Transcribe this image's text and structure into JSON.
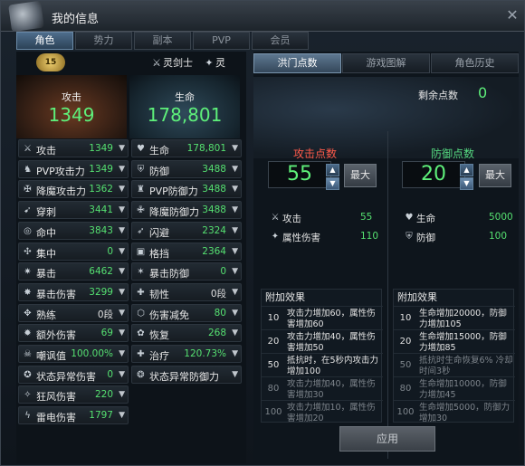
{
  "window": {
    "title": "我的信息"
  },
  "main_tabs": [
    {
      "label": "角色",
      "active": true
    },
    {
      "label": "势力",
      "active": false
    },
    {
      "label": "副本",
      "active": false
    },
    {
      "label": "PVP",
      "active": false
    },
    {
      "label": "会员",
      "active": false
    }
  ],
  "left": {
    "rank_badge": "15",
    "class1": "灵剑士",
    "class2": "灵",
    "attack": {
      "label": "攻击",
      "value": "1349"
    },
    "life": {
      "label": "生命",
      "value": "178,801"
    },
    "stats_left": [
      {
        "icon": "sword-icon",
        "name": "攻击",
        "value": "1349"
      },
      {
        "icon": "pvp-attack-icon",
        "name": "PVP攻击力",
        "value": "1349"
      },
      {
        "icon": "demon-attack-icon",
        "name": "降魔攻击力",
        "value": "1362"
      },
      {
        "icon": "pierce-icon",
        "name": "穿刺",
        "value": "3441"
      },
      {
        "icon": "target-icon",
        "name": "命中",
        "value": "3843"
      },
      {
        "icon": "focus-icon",
        "name": "集中",
        "value": "0"
      },
      {
        "icon": "crit-icon",
        "name": "暴击",
        "value": "6462"
      },
      {
        "icon": "crit-damage-icon",
        "name": "暴击伤害",
        "value": "3299"
      },
      {
        "icon": "skill-icon",
        "name": "熟练",
        "value": "0段"
      },
      {
        "icon": "extra-damage-icon",
        "name": "额外伤害",
        "value": "69"
      },
      {
        "icon": "skull-icon",
        "name": "嘲讽值",
        "value": "100.00%"
      },
      {
        "icon": "status-attack-icon",
        "name": "状态异常伤害",
        "value": "0"
      },
      {
        "icon": "berserk-icon",
        "name": "狂风伤害",
        "value": "220"
      },
      {
        "icon": "thunder-icon",
        "name": "雷电伤害",
        "value": "1797"
      }
    ],
    "stats_right": [
      {
        "icon": "heart-icon",
        "name": "生命",
        "value": "178,801"
      },
      {
        "icon": "shield-icon",
        "name": "防御",
        "value": "3488"
      },
      {
        "icon": "pvp-defense-icon",
        "name": "PVP防御力",
        "value": "3488"
      },
      {
        "icon": "demon-defense-icon",
        "name": "降魔防御力",
        "value": "3488"
      },
      {
        "icon": "evade-icon",
        "name": "闪避",
        "value": "2324"
      },
      {
        "icon": "block-icon",
        "name": "格挡",
        "value": "2364"
      },
      {
        "icon": "crit-defense-icon",
        "name": "暴击防御",
        "value": "0"
      },
      {
        "icon": "toughness-icon",
        "name": "韧性",
        "value": "0段"
      },
      {
        "icon": "damage-reduce-icon",
        "name": "伤害减免",
        "value": "80"
      },
      {
        "icon": "recover-icon",
        "name": "恢复",
        "value": "268"
      },
      {
        "icon": "heal-icon",
        "name": "治疗",
        "value": "120.73%"
      },
      {
        "icon": "status-defense-icon",
        "name": "状态异常防御力",
        "value": ""
      }
    ]
  },
  "right": {
    "sub_tabs": [
      {
        "label": "洪门点数",
        "active": true
      },
      {
        "label": "游戏图解",
        "active": false
      },
      {
        "label": "角色历史",
        "active": false
      }
    ],
    "remaining_label": "剩余点数",
    "remaining_value": "0",
    "attack_points": {
      "label": "攻击点数",
      "value": "55",
      "max_label": "最大",
      "effects": [
        {
          "icon": "sword-icon",
          "name": "攻击",
          "value": "55"
        },
        {
          "icon": "element-icon",
          "name": "属性伤害",
          "value": "110"
        }
      ],
      "bonus_title": "附加效果",
      "bonus": [
        {
          "level": "10",
          "text": "攻击力增加60，属性伤害增加60",
          "active": true
        },
        {
          "level": "20",
          "text": "攻击力增加40，属性伤害增加50",
          "active": true
        },
        {
          "level": "50",
          "text": "抵抗时，在5秒内攻击力增加100",
          "active": true
        },
        {
          "level": "80",
          "text": "攻击力增加40，属性伤害增加30",
          "active": false
        },
        {
          "level": "100",
          "text": "攻击力增加10，属性伤害增加20",
          "active": false
        }
      ]
    },
    "defense_points": {
      "label": "防御点数",
      "value": "20",
      "max_label": "最大",
      "effects": [
        {
          "icon": "heart-icon",
          "name": "生命",
          "value": "5000"
        },
        {
          "icon": "shield-icon",
          "name": "防御",
          "value": "100"
        }
      ],
      "bonus_title": "附加效果",
      "bonus": [
        {
          "level": "10",
          "text": "生命增加20000，防御力增加105",
          "active": true
        },
        {
          "level": "20",
          "text": "生命增加15000，防御力增加85",
          "active": true
        },
        {
          "level": "50",
          "text": "抵抗时生命恢复6% 冷却时间3秒",
          "active": false
        },
        {
          "level": "80",
          "text": "生命增加10000，防御力增加45",
          "active": false
        },
        {
          "level": "100",
          "text": "生命增加5000，防御力增加30",
          "active": false
        }
      ]
    },
    "apply_label": "应用"
  }
}
